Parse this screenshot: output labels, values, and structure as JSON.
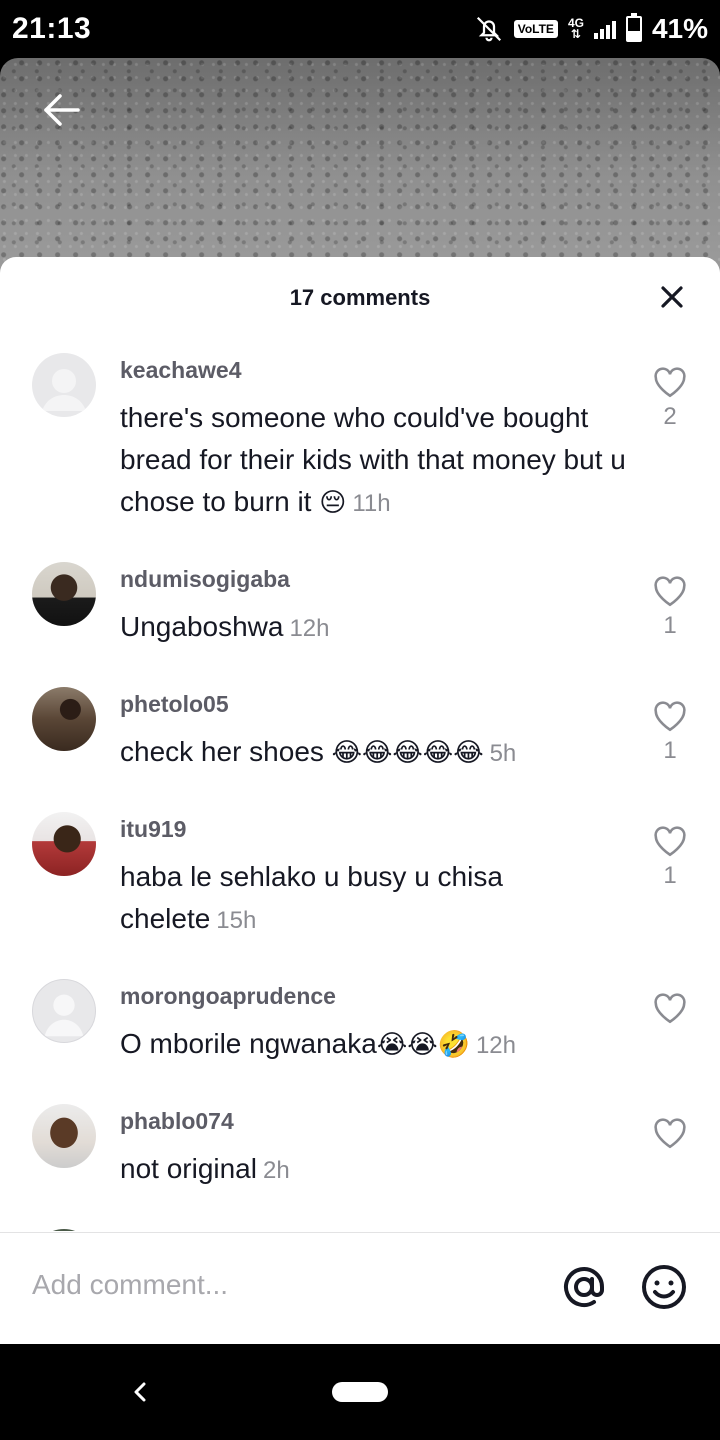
{
  "status_bar": {
    "time": "21:13",
    "network_badge": "VoLTE",
    "network_type": "4G",
    "battery_percent": "41%",
    "battery_level": 0.41,
    "icons": [
      "notifications-off-icon",
      "signal-icon",
      "battery-icon"
    ]
  },
  "header": {
    "back_icon": "arrow-left-icon",
    "title": "17 comments",
    "close_icon": "close-icon"
  },
  "comments": [
    {
      "username": "keachawe4",
      "text": "there's someone who could've bought bread for their kids with that money but u chose to burn it ",
      "emoji": "😔",
      "time": "11h",
      "likes": "2"
    },
    {
      "username": "ndumisogigaba",
      "text": "Ungaboshwa",
      "emoji": "",
      "time": "12h",
      "likes": "1"
    },
    {
      "username": "phetolo05",
      "text": "check her shoes ",
      "emoji": "😂😂😂😂😂",
      "time": "5h",
      "likes": "1"
    },
    {
      "username": "itu919",
      "text": "haba le sehlako u busy u chisa chelete",
      "emoji": "",
      "time": "15h",
      "likes": "1"
    },
    {
      "username": "morongoaprudence",
      "text": "O mborile ngwanaka",
      "emoji": "😭😭🤣",
      "time": "12h",
      "likes": ""
    },
    {
      "username": "phablo074",
      "text": "not original",
      "emoji": "",
      "time": "2h",
      "likes": ""
    }
  ],
  "input": {
    "placeholder": "Add comment...",
    "mention_icon": "at-sign-icon",
    "emoji_icon": "smiley-icon"
  },
  "colors": {
    "text_primary": "#161823",
    "text_secondary": "#8a8b91",
    "username": "#5c5c66"
  }
}
